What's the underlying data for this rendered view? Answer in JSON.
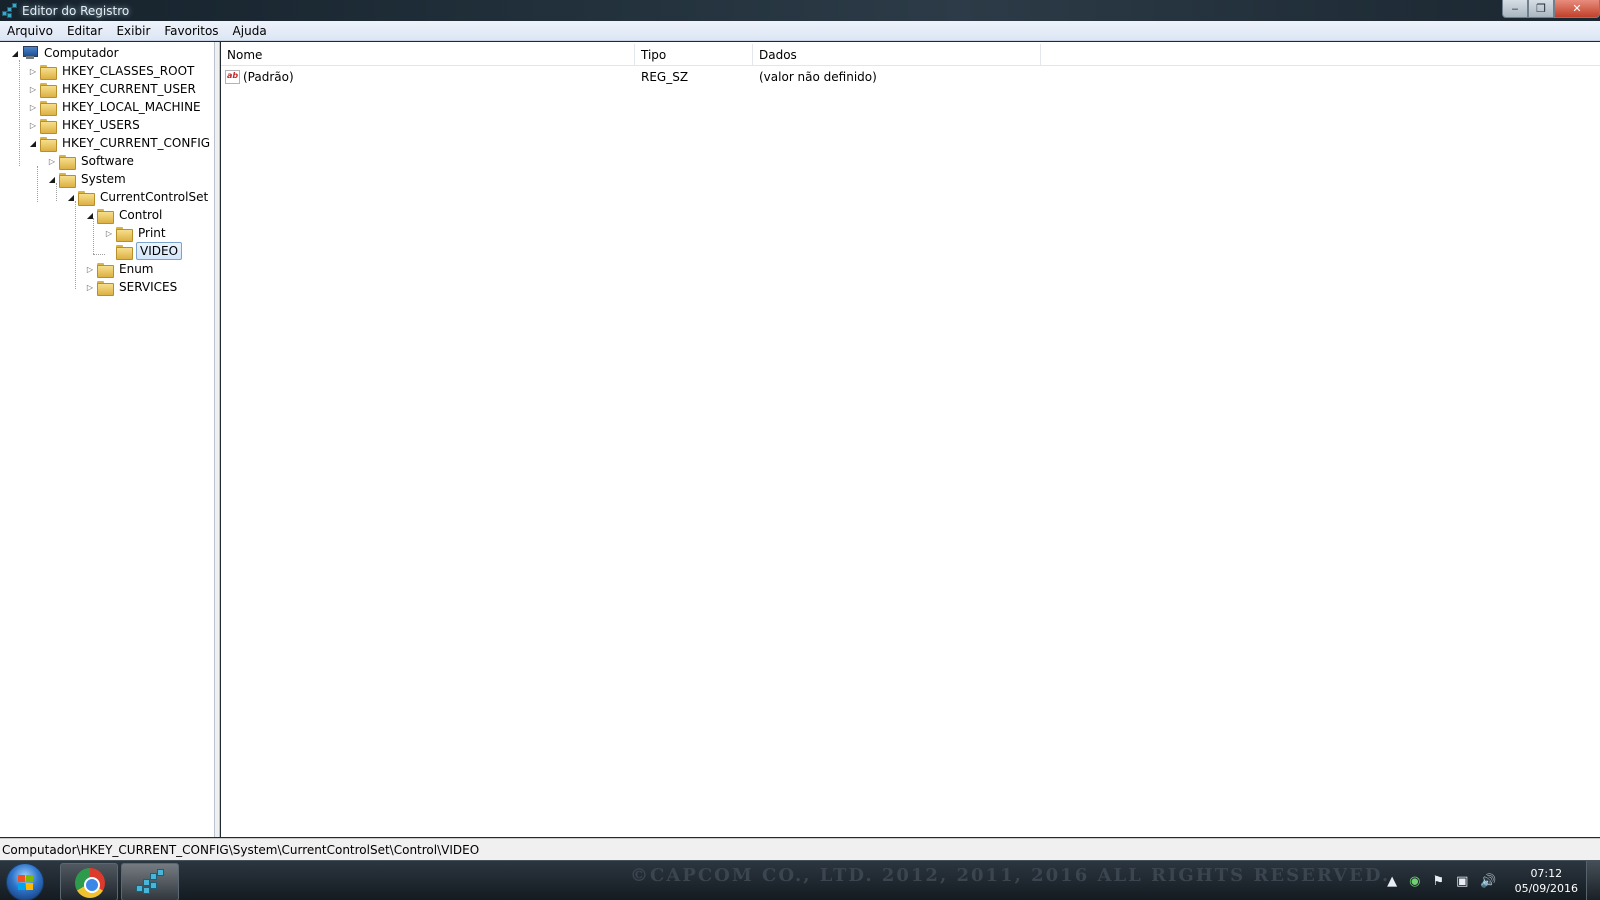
{
  "window": {
    "title": "Editor do Registro",
    "min": "‒",
    "max": "❐",
    "close": "✕"
  },
  "menu": [
    "Arquivo",
    "Editar",
    "Exibir",
    "Favoritos",
    "Ajuda"
  ],
  "tree": {
    "root": "Computador",
    "items": {
      "hkcr": "HKEY_CLASSES_ROOT",
      "hkcu": "HKEY_CURRENT_USER",
      "hklm": "HKEY_LOCAL_MACHINE",
      "hku": "HKEY_USERS",
      "hkcc": "HKEY_CURRENT_CONFIG",
      "software": "Software",
      "system": "System",
      "ccs": "CurrentControlSet",
      "control": "Control",
      "print": "Print",
      "video": "VIDEO",
      "enum": "Enum",
      "services": "SERVICES"
    },
    "selected": "VIDEO"
  },
  "list": {
    "columns": [
      "Nome",
      "Tipo",
      "Dados"
    ],
    "rows": [
      {
        "name": "(Padrão)",
        "type": "REG_SZ",
        "data": "(valor não definido)"
      }
    ],
    "value_icon_text": "ab"
  },
  "status": "Computador\\HKEY_CURRENT_CONFIG\\System\\CurrentControlSet\\Control\\VIDEO",
  "taskbar": {
    "apps": [
      "chrome-icon",
      "regedit-icon"
    ],
    "watermark": "©CAPCOM CO., LTD. 2012, 2011, 2016 ALL RIGHTS RESERVED.",
    "time": "07:12",
    "date": "05/09/2016"
  },
  "colors": {
    "selection_border": "#7da2ce",
    "menubar": "#dce6f4",
    "taskbar": "#141b21"
  }
}
